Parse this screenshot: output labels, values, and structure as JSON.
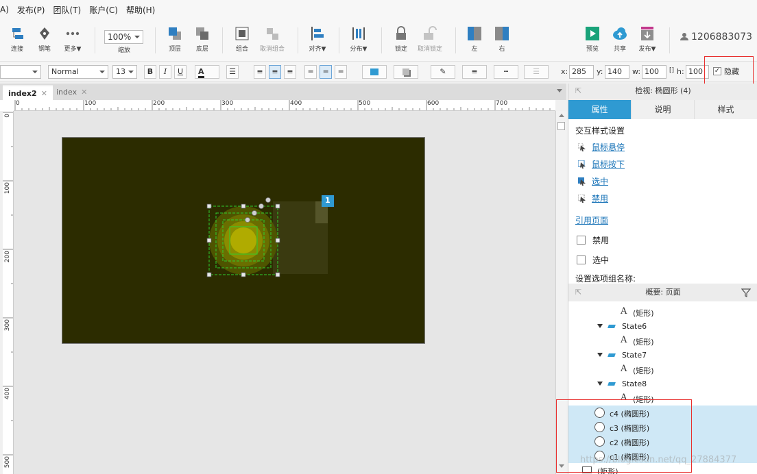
{
  "menu": {
    "items": [
      "A)",
      "发布(P)",
      "团队(T)",
      "账户(C)",
      "帮助(H)"
    ]
  },
  "toolbar": {
    "connect": "连接",
    "pen": "钢笔",
    "more": "更多▼",
    "zoom_value": "100%",
    "zoom_label": "缩放",
    "top": "顶层",
    "bottom": "底层",
    "group": "组合",
    "ungroup": "取消组合",
    "align": "对齐▼",
    "distribute": "分布▼",
    "lock": "锁定",
    "unlock": "取消锁定",
    "left": "左",
    "right": "右",
    "preview": "预览",
    "share": "共享",
    "publish": "发布▼",
    "user": "1206883073"
  },
  "format": {
    "style": "Normal",
    "font_size": "13",
    "bold": "B",
    "italic": "I",
    "underline": "U",
    "font_color": "A",
    "x_label": "x:",
    "x": "285",
    "y_label": "y:",
    "y": "140",
    "w_label": "w:",
    "w": "100",
    "h_label": "h:",
    "h": "100",
    "hide_label": "隐藏",
    "hide_checked": "✓"
  },
  "tabs": [
    {
      "label": "index2",
      "close": "✕"
    },
    {
      "label": "index",
      "close": "✕"
    }
  ],
  "ruler": {
    "h_ticks": [
      "0",
      "100",
      "200",
      "300",
      "400",
      "500",
      "600",
      "700"
    ],
    "v_ticks": [
      "0",
      "100",
      "200",
      "300",
      "400",
      "500"
    ]
  },
  "canvas": {
    "badge": "1",
    "bg_color": "#2c2c00"
  },
  "inspector": {
    "title": "检视: 椭圆形 (4)",
    "tabs": [
      "属性",
      "说明",
      "样式"
    ],
    "section": "交互样式设置",
    "links": [
      "鼠标悬停",
      "鼠标按下",
      "选中",
      "禁用"
    ],
    "ref_page": "引用页面",
    "checks": [
      "禁用",
      "选中"
    ],
    "group_name": "设置选项组名称:"
  },
  "outline": {
    "title": "概要: 页面",
    "rows": [
      {
        "type": "text",
        "label": "(矩形)"
      },
      {
        "type": "state",
        "label": "State6"
      },
      {
        "type": "text",
        "label": "(矩形)"
      },
      {
        "type": "state",
        "label": "State7"
      },
      {
        "type": "text",
        "label": "(矩形)"
      },
      {
        "type": "state",
        "label": "State8"
      },
      {
        "type": "text",
        "label": "(矩形)"
      },
      {
        "type": "ellipse",
        "label": "c4 (椭圆形)"
      },
      {
        "type": "ellipse",
        "label": "c3 (椭圆形)"
      },
      {
        "type": "ellipse",
        "label": "c2 (椭圆形)"
      },
      {
        "type": "ellipse",
        "label": "c1 (椭圆形)"
      },
      {
        "type": "rect",
        "label": "(矩形)"
      }
    ]
  },
  "watermark": "https://blog.csdn.net/qq_27884377",
  "colors": {
    "accent": "#2f9ad2",
    "highlight_red": "#e8302f",
    "selected_row": "#cfe8f6"
  }
}
